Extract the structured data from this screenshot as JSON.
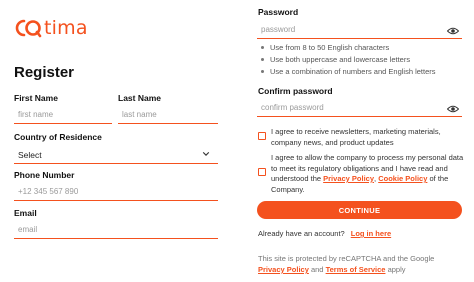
{
  "brand": {
    "logo_text": "tima",
    "accent": "#f4511e"
  },
  "form": {
    "title": "Register",
    "first_name": {
      "label": "First Name",
      "placeholder": "first name"
    },
    "last_name": {
      "label": "Last Name",
      "placeholder": "last name"
    },
    "country": {
      "label": "Country of Residence",
      "value": "Select"
    },
    "phone": {
      "label": "Phone Number",
      "placeholder": "+12 345 567 890"
    },
    "email": {
      "label": "Email",
      "placeholder": "email"
    },
    "password": {
      "label": "Password",
      "placeholder": "password",
      "hints": [
        "Use from 8 to 50 English characters",
        "Use both uppercase and lowercase letters",
        "Use a combination of numbers and English letters"
      ]
    },
    "confirm_password": {
      "label": "Confirm password",
      "placeholder": "confirm password"
    },
    "newsletter_consent": "I agree to receive newsletters, marketing materials, company news, and product updates",
    "data_consent": {
      "text_before": "I agree to allow the company to process my personal data to meet its regulatory obligations and I have read and understood the",
      "privacy_link": "Privacy Policy",
      "separator": ",",
      "cookie_link": "Cookie Policy",
      "text_after": "of the Company."
    },
    "submit_label": "CONTINUE",
    "have_account_text": "Already have an account?",
    "login_link": "Log in here",
    "recaptcha": {
      "text_before": "This site is protected by reCAPTCHA and the Google",
      "privacy_link": "Privacy Policy",
      "and": "and",
      "terms_link": "Terms of Service",
      "apply": "apply"
    }
  }
}
